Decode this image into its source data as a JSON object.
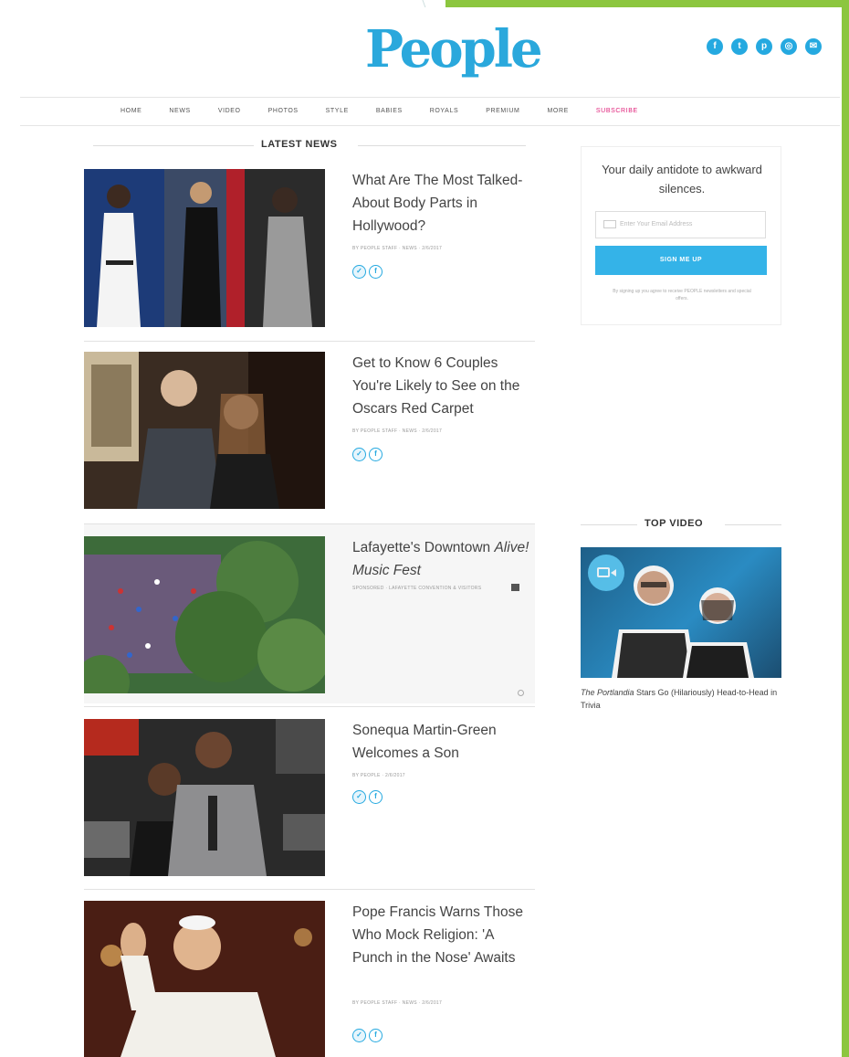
{
  "brand": {
    "logo_text": "People"
  },
  "social": [
    {
      "icon": "facebook-icon",
      "glyph": "f"
    },
    {
      "icon": "twitter-icon",
      "glyph": "t"
    },
    {
      "icon": "pinterest-icon",
      "glyph": "p"
    },
    {
      "icon": "instagram-icon",
      "glyph": "◎"
    },
    {
      "icon": "email-icon",
      "glyph": "✉"
    }
  ],
  "nav": {
    "items": [
      "HOME",
      "NEWS",
      "VIDEO",
      "PHOTOS",
      "STYLE",
      "BABIES",
      "ROYALS",
      "PREMIUM",
      "MORE"
    ],
    "subscribe": "SUBSCRIBE"
  },
  "latest_news": {
    "heading": "LATEST NEWS",
    "articles": [
      {
        "title": "What Are The Most Talked-About Body Parts in Hollywood?",
        "byline": "BY PEOPLE STAFF · NEWS · 2/6/2017",
        "share_tw": "✓",
        "share_fb": "f"
      },
      {
        "title": "Get to Know 6 Couples You're Likely to See on the Oscars Red Carpet",
        "byline": "BY PEOPLE STAFF · NEWS · 2/6/2017",
        "share_tw": "✓",
        "share_fb": "f"
      },
      {
        "title_plain": "Lafayette's Downtown ",
        "title_em": "Alive! Music Fest",
        "byline": "SPONSORED · LAFAYETTE CONVENTION & VISITORS"
      },
      {
        "title": "Sonequa Martin-Green Welcomes a Son",
        "byline": "BY PEOPLE · 2/6/2017",
        "share_tw": "✓",
        "share_fb": "f"
      },
      {
        "title": "Pope Francis Warns Those Who Mock Religion: 'A Punch in the Nose' Awaits",
        "byline": "BY PEOPLE STAFF · NEWS · 2/6/2017",
        "share_tw": "✓",
        "share_fb": "f"
      }
    ]
  },
  "newsletter": {
    "tagline": "Your daily antidote to awkward silences.",
    "email_placeholder": "Enter Your Email Address",
    "signup_label": "SIGN ME UP",
    "fine_print": "By signing up you agree to receive PEOPLE newsletters and special offers."
  },
  "top_video": {
    "heading": "TOP VIDEO",
    "caption_em": "The Portlandia",
    "caption_rest": " Stars Go (Hilariously) Head-to-Head in Trivia"
  },
  "colors": {
    "accent": "#25a9e0",
    "subscribe": "#e0217a",
    "slide_accent": "#8cc63f"
  }
}
